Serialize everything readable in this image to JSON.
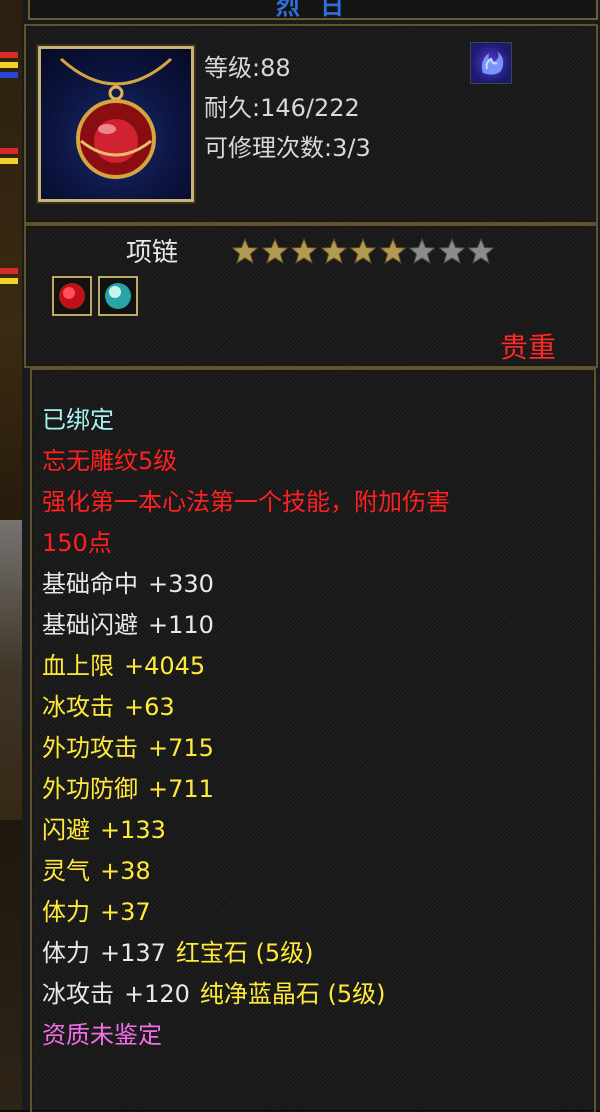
{
  "title": "烈 日",
  "item": {
    "level_text": "等级:88",
    "durability_text": "耐久:146/222",
    "repair_text": "可修理次数:3/3",
    "name": "项链",
    "star_rating": {
      "filled": 6,
      "total": 9
    },
    "rarity": "贵重",
    "gems": [
      "red-gem-icon",
      "blue-crystal-icon"
    ]
  },
  "attributes": {
    "bound": "已绑定",
    "engraving": "忘无雕纹5级",
    "effect_line1": "强化第一本心法第一个技能，附加伤害",
    "effect_line2": "150点",
    "white_stats": [
      {
        "label": "基础命中",
        "value": "+330"
      },
      {
        "label": "基础闪避",
        "value": "+110"
      }
    ],
    "yellow_stats": [
      {
        "label": "血上限",
        "value": "+4045"
      },
      {
        "label": "冰攻击",
        "value": "+63"
      },
      {
        "label": "外功攻击",
        "value": "+715"
      },
      {
        "label": "外功防御",
        "value": "+711"
      },
      {
        "label": "闪避",
        "value": "+133"
      },
      {
        "label": "灵气",
        "value": "+38"
      },
      {
        "label": "体力",
        "value": "+37"
      }
    ],
    "gem_stats": [
      {
        "label": "体力",
        "value": "+137",
        "source": "红宝石 (5级)"
      },
      {
        "label": "冰攻击",
        "value": "+120",
        "source": "纯净蓝晶石 (5级)"
      }
    ],
    "aptitude": "资质未鉴定"
  },
  "colors": {
    "bound": "#a9f2f2",
    "red": "#ff2020",
    "white": "#e8e8e8",
    "yellow": "#ffea3a",
    "pink": "#f26ee6",
    "gold_border": "#5e5230",
    "star_filled": "#b29a52",
    "star_empty": "#8c8c8c"
  }
}
